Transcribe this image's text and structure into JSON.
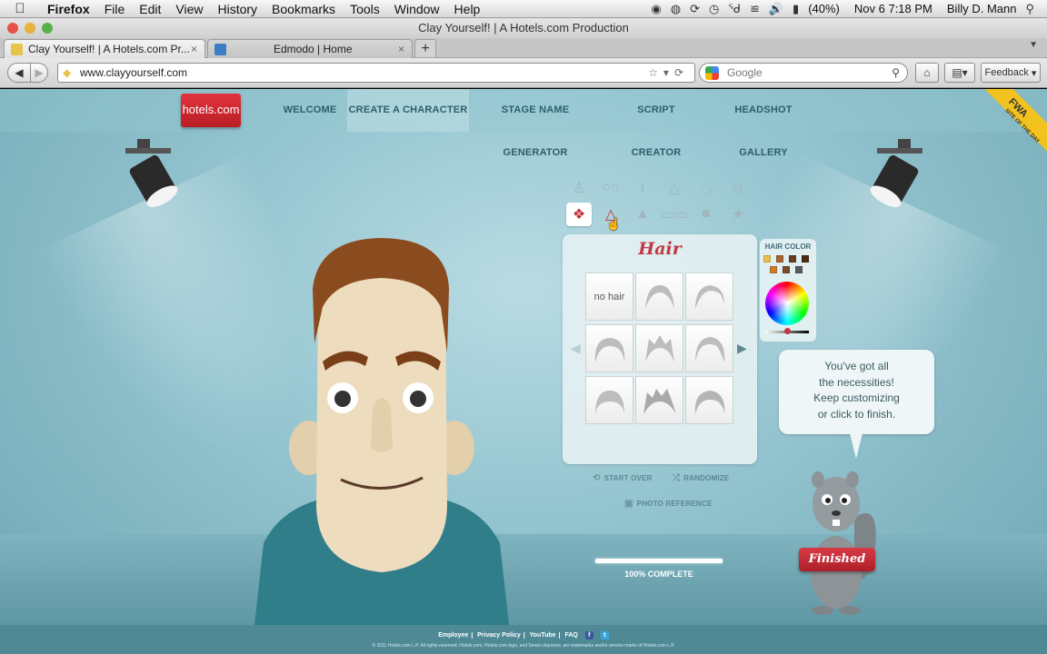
{
  "menubar": {
    "app": "Firefox",
    "menus": [
      "File",
      "Edit",
      "View",
      "History",
      "Bookmarks",
      "Tools",
      "Window",
      "Help"
    ],
    "battery": "(40%)",
    "datetime": "Nov 6  7:18 PM",
    "user": "Billy D. Mann"
  },
  "window": {
    "title": "Clay Yourself! | A Hotels.com Production"
  },
  "tabs": [
    {
      "label": "Clay Yourself! | A Hotels.com Pr...",
      "close": "×",
      "icon_color": "#e8c44a"
    },
    {
      "label": "Edmodo | Home",
      "close": "×",
      "icon_color": "#3c7ec4"
    }
  ],
  "new_tab_label": "+",
  "navbar": {
    "url": "www.clayyourself.com",
    "search_placeholder": "Google",
    "feedback_label": "Feedback"
  },
  "site": {
    "logo": "hotels.com",
    "nav": [
      "WELCOME",
      "CREATE A CHARACTER",
      "STAGE NAME GENERATOR",
      "SCRIPT CREATOR",
      "HEADSHOT GALLERY"
    ],
    "active_nav": "CREATE A CHARACTER",
    "ribbon": "FWA",
    "ribbon_sub": "SITE OF THE DAY"
  },
  "editor": {
    "category_icons_row1": [
      "body-icon",
      "eyes-icon",
      "eyebrows-icon",
      "nose-icon",
      "mouth-icon",
      "ears-icon"
    ],
    "category_icons_row2": [
      "hair-icon",
      "facial-hair-icon",
      "hat-icon",
      "glasses-icon",
      "shirt-icon",
      "star-icon"
    ],
    "selected_category": "hair-icon",
    "panel_title": "Hair",
    "no_hair_label": "no hair",
    "hair_color_label": "HAIR COLOR",
    "hair_colors": [
      "#e6c04a",
      "#a8652d",
      "#6a3e1f",
      "#4a2a16",
      "#c97b2a",
      "#7a4a2a",
      "#5a5a5a",
      "#111111"
    ],
    "start_over_label": "START OVER",
    "randomize_label": "RANDOMIZE",
    "photo_reference_label": "PHOTO REFERENCE",
    "progress_percent": 100,
    "progress_label": "100% COMPLETE"
  },
  "bubble": {
    "lines": [
      "You've got all",
      "the necessities!",
      "Keep customizing",
      "or click to finish."
    ]
  },
  "finished_label": "Finished",
  "footer": {
    "links": [
      "Employee",
      "Privacy Policy",
      "YouTube",
      "FAQ"
    ],
    "copyright": "© 2011 Hotels.com L.P.  All rights reserved.  Hotels.com, Hotels.com logo, and Smart character, are trademarks and/or service marks of Hotels.com L.P."
  }
}
